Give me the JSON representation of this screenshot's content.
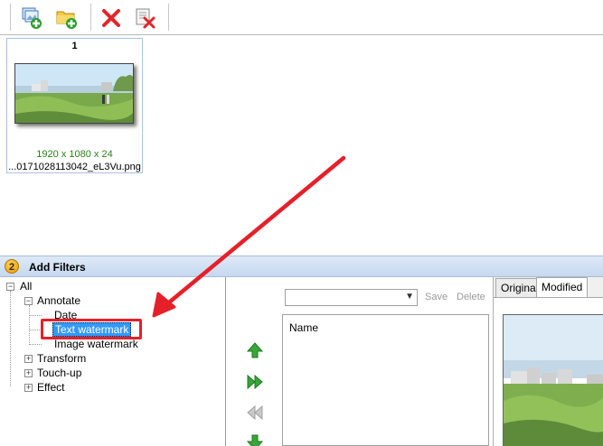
{
  "toolbar": {
    "buttons": [
      {
        "name": "add-images-button",
        "icon": "add-images-icon"
      },
      {
        "name": "add-folder-button",
        "icon": "add-folder-icon"
      },
      {
        "name": "remove-button",
        "icon": "remove-x-icon"
      },
      {
        "name": "remove-all-button",
        "icon": "clear-list-icon"
      }
    ]
  },
  "thumbnail": {
    "index": "1",
    "dimensions": "1920 x 1080 x 24",
    "filename": "...0171028113042_eL3Vu.png"
  },
  "filters_panel": {
    "step": "2",
    "title": "Add Filters"
  },
  "tree": {
    "root": "All",
    "annotate": "Annotate",
    "date": "Date",
    "text_watermark": "Text watermark",
    "image_watermark": "Image watermark",
    "transform": "Transform",
    "touch_up": "Touch-up",
    "effect": "Effect"
  },
  "filter_list": {
    "save_label": "Save",
    "delete_label": "Delete",
    "column_name": "Name"
  },
  "preview": {
    "tab_original": "Original",
    "tab_modified": "Modified"
  },
  "colors": {
    "annotation_red": "#e5202a",
    "selection_blue": "#3399ff",
    "dimension_green": "#2a7f16"
  }
}
